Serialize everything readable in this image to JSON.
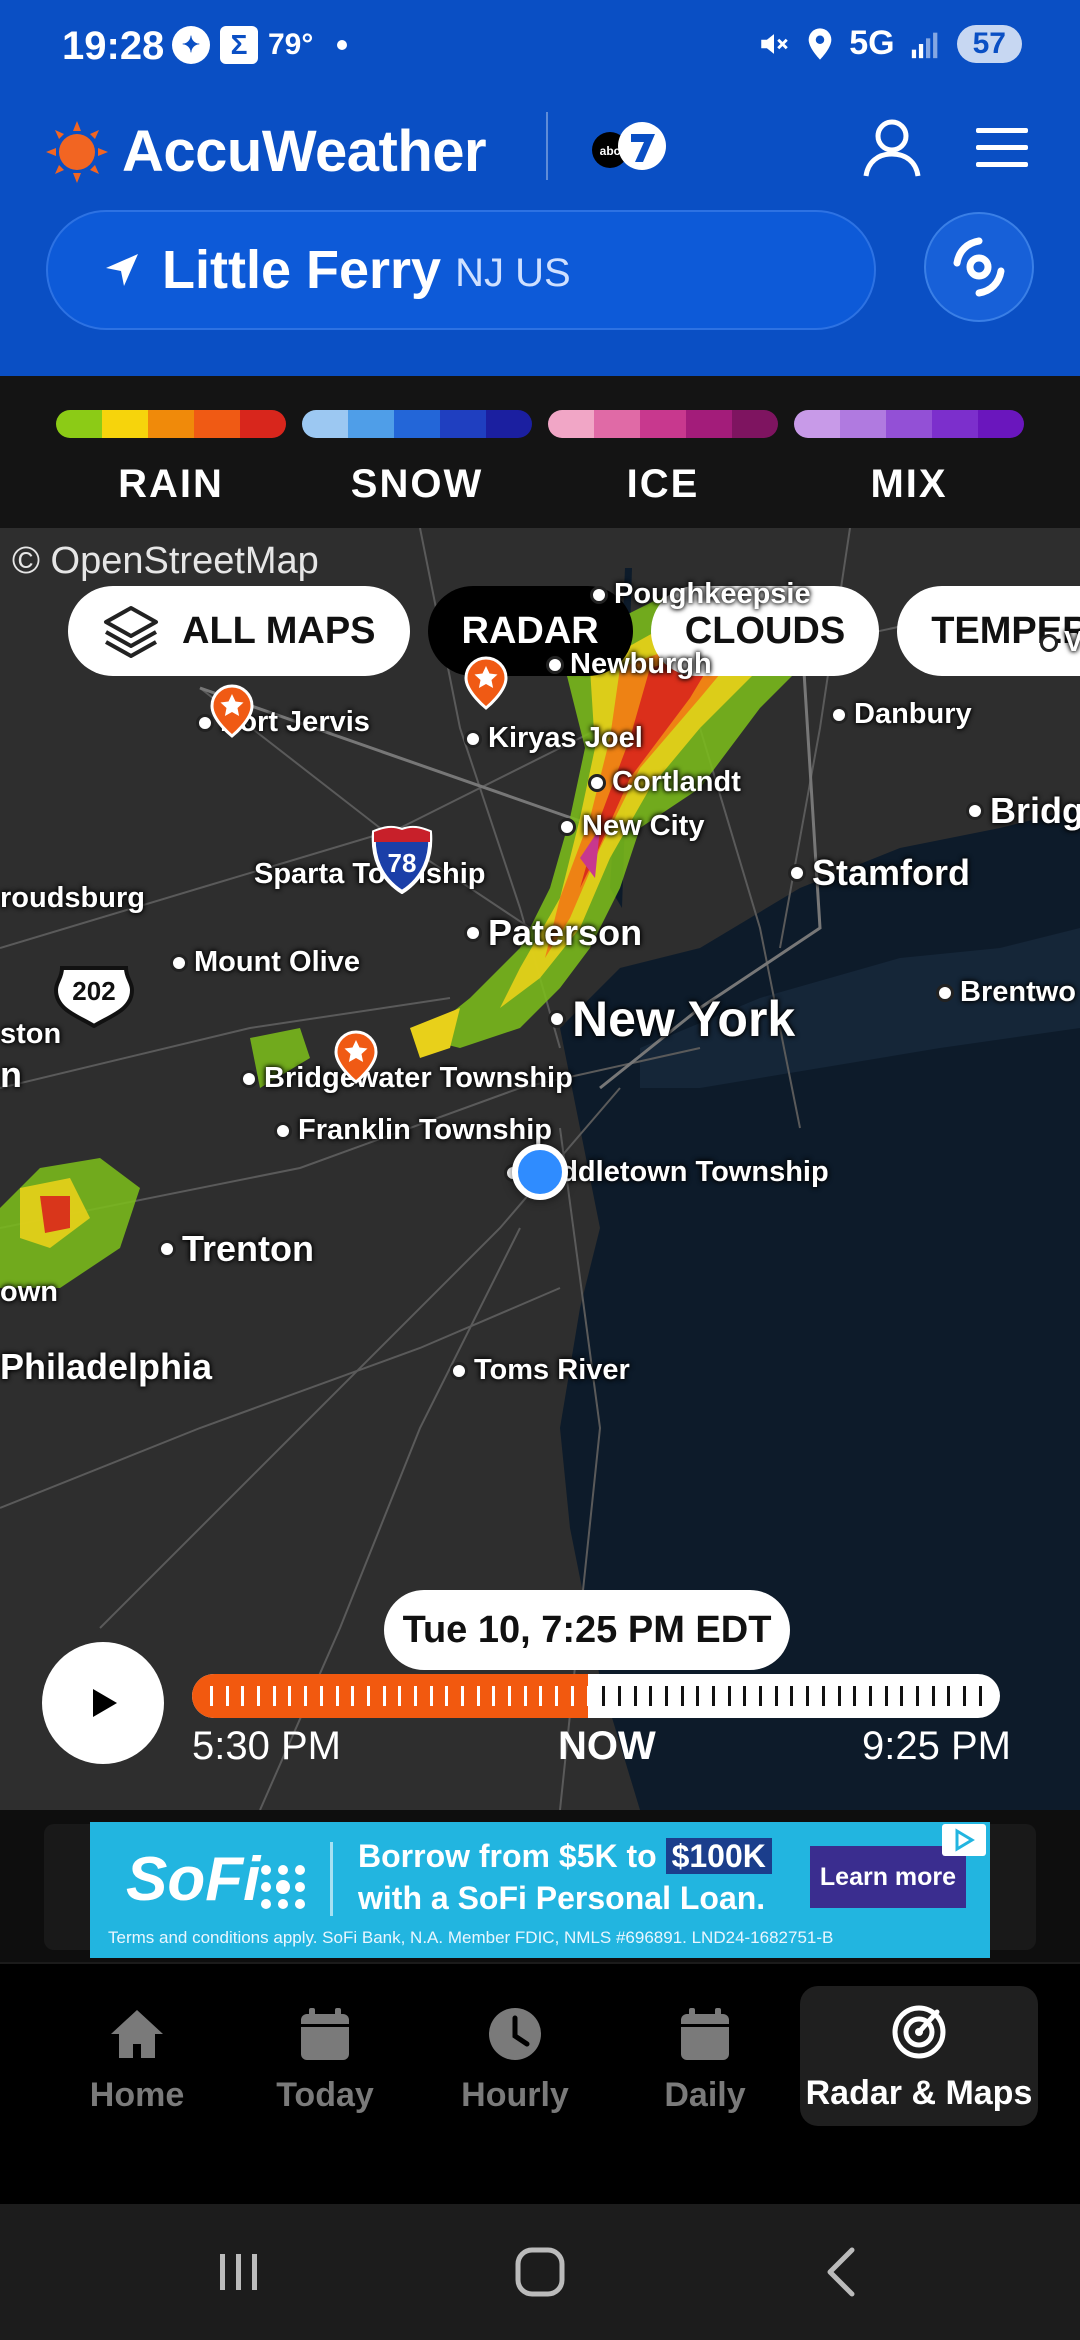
{
  "status_bar": {
    "time": "19:28",
    "sigma": "Σ",
    "temp": "79°",
    "network": "5G",
    "battery": "57"
  },
  "header": {
    "app_name": "AccuWeather",
    "partner": "abc7",
    "location_name": "Little Ferry",
    "location_region": "NJ US"
  },
  "legend": [
    {
      "label": "RAIN",
      "colors": [
        "#8ccb16",
        "#f6d40c",
        "#f08a0a",
        "#f05a14",
        "#d8261c"
      ]
    },
    {
      "label": "SNOW",
      "colors": [
        "#9cc8f2",
        "#4f9ee8",
        "#2366d8",
        "#1f3fc0",
        "#1b1fa0"
      ]
    },
    {
      "label": "ICE",
      "colors": [
        "#f1a6c6",
        "#e06aa6",
        "#c8388e",
        "#a31c7a",
        "#7e1460"
      ]
    },
    {
      "label": "MIX",
      "colors": [
        "#c89ae8",
        "#b07ae0",
        "#9350d6",
        "#7c2fcc",
        "#6a16bd"
      ]
    }
  ],
  "map": {
    "credit": "© OpenStreetMap",
    "tabs": [
      "ALL MAPS",
      "RADAR",
      "CLOUDS",
      "TEMPERAT"
    ],
    "cities": [
      {
        "name": "Poughkeepsie",
        "size": "small"
      },
      {
        "name": "Newburgh",
        "size": "small"
      },
      {
        "name": "Port Jervis",
        "size": "small"
      },
      {
        "name": "Kiryas Joel",
        "size": "small"
      },
      {
        "name": "Danbury",
        "size": "small"
      },
      {
        "name": "Cortlandt",
        "size": "small"
      },
      {
        "name": "New City",
        "size": "small"
      },
      {
        "name": "Bridg",
        "size": "mid"
      },
      {
        "name": "Stamford",
        "size": "mid"
      },
      {
        "name": "Sparta Township",
        "size": "small"
      },
      {
        "name": "roudsburg",
        "size": "small"
      },
      {
        "name": "Paterson",
        "size": "mid"
      },
      {
        "name": "Mount Olive",
        "size": "small"
      },
      {
        "name": "Brentwo",
        "size": "small"
      },
      {
        "name": "New York",
        "size": "big"
      },
      {
        "name": "ston",
        "size": "small"
      },
      {
        "name": "Bridgewater Township",
        "size": "small"
      },
      {
        "name": "Franklin Township",
        "size": "small"
      },
      {
        "name": "Middletown Township",
        "size": "small"
      },
      {
        "name": "Trenton",
        "size": "mid"
      },
      {
        "name": "Toms River",
        "size": "small"
      },
      {
        "name": "Philadelphia",
        "size": "mid"
      },
      {
        "name": "n",
        "size": "mid"
      },
      {
        "name": "own",
        "size": "small"
      },
      {
        "name": "V",
        "size": "small"
      }
    ],
    "shields": {
      "interstate": "78",
      "us_route": "202"
    },
    "timestamp": "Tue 10, 7:25 PM EDT",
    "timeline": {
      "start": "5:30 PM",
      "now": "NOW",
      "end": "9:25 PM",
      "progress": 0.49
    }
  },
  "ad": {
    "brand": "SoFi",
    "line1_prefix": "Borrow from $5K to",
    "line1_highlight": "$100K",
    "line2": "with a SoFi Personal Loan.",
    "cta": "Learn more",
    "terms": "Terms and conditions apply. SoFi Bank, N.A. Member FDIC, NMLS #696891. LND24-1682751-B"
  },
  "bottom_nav": [
    {
      "label": "Home",
      "icon": "home-icon"
    },
    {
      "label": "Today",
      "icon": "calendar-icon"
    },
    {
      "label": "Hourly",
      "icon": "clock-icon"
    },
    {
      "label": "Daily",
      "icon": "calendar-icon"
    },
    {
      "label": "Radar & Maps",
      "icon": "radar-icon"
    }
  ]
}
